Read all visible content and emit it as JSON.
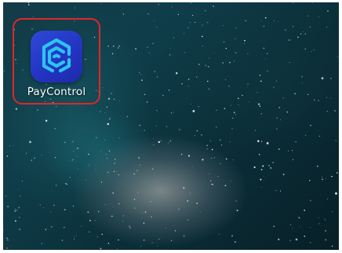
{
  "home_screen": {
    "apps": [
      {
        "label": "PayControl",
        "icon": "paycontrol-logo-icon",
        "highlighted": true
      }
    ]
  },
  "colors": {
    "highlight_border": "#e0262a",
    "app_icon_background": "#2434c2",
    "app_icon_glyph": "#29c6f2",
    "wallpaper": "#0f3e4a"
  }
}
